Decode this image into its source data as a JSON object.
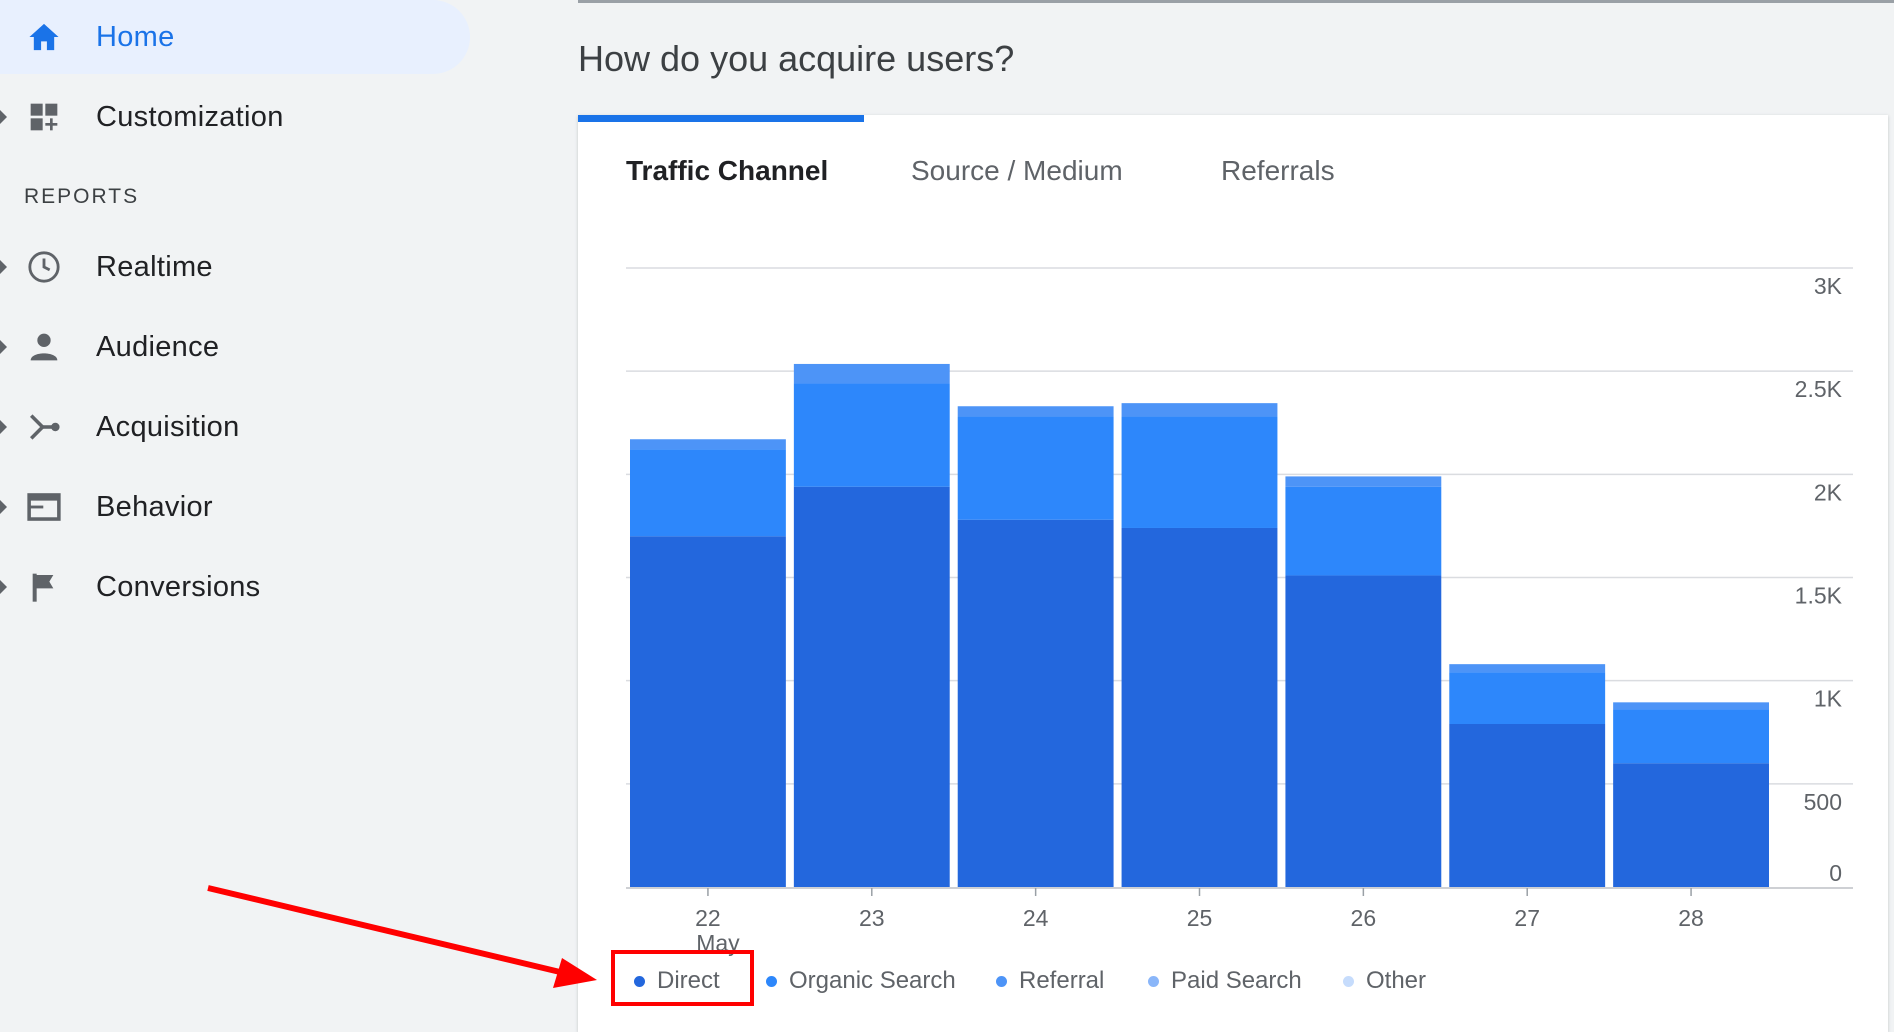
{
  "sidebar": {
    "home_label": "Home",
    "customization_label": "Customization",
    "reports_heading": "REPORTS",
    "items": [
      {
        "label": "Realtime"
      },
      {
        "label": "Audience"
      },
      {
        "label": "Acquisition"
      },
      {
        "label": "Behavior"
      },
      {
        "label": "Conversions"
      }
    ]
  },
  "main": {
    "question": "How do you acquire users?",
    "tabs": [
      {
        "label": "Traffic Channel",
        "active": true
      },
      {
        "label": "Source / Medium",
        "active": false
      },
      {
        "label": "Referrals",
        "active": false
      }
    ]
  },
  "colors": {
    "accent": "#1a73e8",
    "direct": "#2367dd",
    "organic": "#2d87fb",
    "referral": "#4d94f7",
    "paid": "#6aa6f9",
    "other": "#c6dcfc",
    "annotation": "#ff0000"
  },
  "chart_data": {
    "type": "bar",
    "stacked": true,
    "categories": [
      "22",
      "23",
      "24",
      "25",
      "26",
      "27",
      "28"
    ],
    "category_sublabels": [
      "May",
      "",
      "",
      "",
      "",
      "",
      ""
    ],
    "series": [
      {
        "name": "Direct",
        "values": [
          1700,
          1940,
          1780,
          1740,
          1510,
          790,
          600
        ]
      },
      {
        "name": "Organic Search",
        "values": [
          420,
          500,
          500,
          540,
          430,
          250,
          260
        ]
      },
      {
        "name": "Referral",
        "values": [
          50,
          95,
          50,
          65,
          50,
          40,
          35
        ]
      },
      {
        "name": "Paid Search",
        "values": [
          0,
          0,
          0,
          0,
          0,
          0,
          0
        ]
      },
      {
        "name": "Other",
        "values": [
          0,
          0,
          0,
          0,
          0,
          0,
          0
        ]
      }
    ],
    "y_ticks": [
      "0",
      "500",
      "1K",
      "1.5K",
      "2K",
      "2.5K",
      "3K"
    ],
    "ylim": [
      0,
      3000
    ],
    "grid": true,
    "legend_position": "bottom"
  },
  "annotation": {
    "highlighted_legend_item": "Direct"
  }
}
